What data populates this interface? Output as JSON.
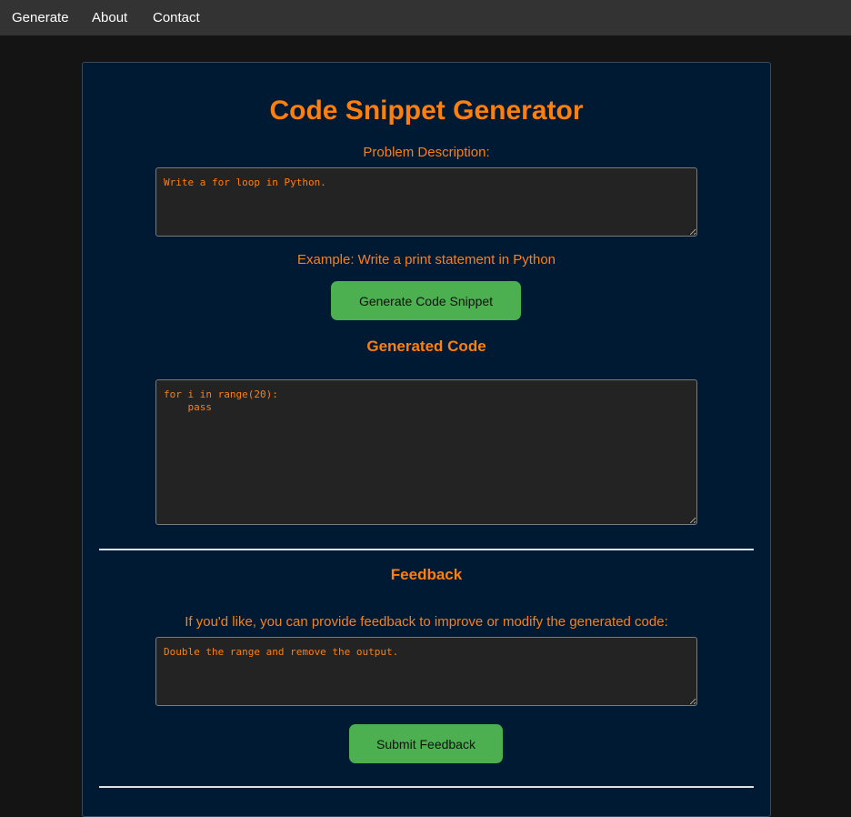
{
  "nav": {
    "items": [
      "Generate",
      "About",
      "Contact"
    ]
  },
  "main": {
    "title": "Code Snippet Generator",
    "problem_label": "Problem Description:",
    "problem_value": "Write a for loop in Python.",
    "example_text": "Example: Write a print statement in Python",
    "generate_button": "Generate Code Snippet",
    "generated_heading": "Generated Code",
    "generated_code": "for i in range(20):\n    pass",
    "feedback_heading": "Feedback",
    "feedback_label": "If you'd like, you can provide feedback to improve or modify the generated code:",
    "feedback_value": "Double the range and remove the output.",
    "submit_button": "Submit Feedback"
  },
  "colors": {
    "accent": "#ff7f0e",
    "button": "#4caf50",
    "card_bg": "#001a33",
    "nav_bg": "#333333",
    "page_bg": "#141414"
  }
}
